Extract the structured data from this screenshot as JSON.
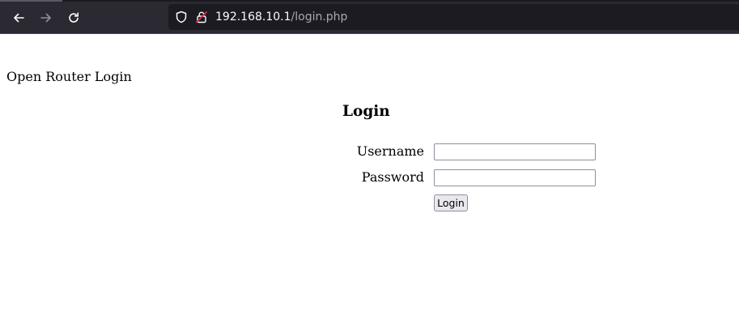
{
  "browser": {
    "nav": {
      "back_icon": "arrow-left-icon",
      "forward_icon": "arrow-right-icon",
      "reload_icon": "reload-icon"
    },
    "urlbar": {
      "host": "192.168.10.1",
      "path": "/login.php",
      "security_icons": [
        "shield-icon",
        "insecure-lock-icon"
      ]
    }
  },
  "page": {
    "site_title": "Open Router Login",
    "heading": "Login",
    "form": {
      "username_label": "Username",
      "username_value": "",
      "password_label": "Password",
      "password_value": "",
      "submit_label": "Login"
    }
  },
  "colors": {
    "toolbar_bg": "#2b2a33",
    "urlbar_bg": "#1c1b22",
    "insecure_lock": "#e22850"
  }
}
